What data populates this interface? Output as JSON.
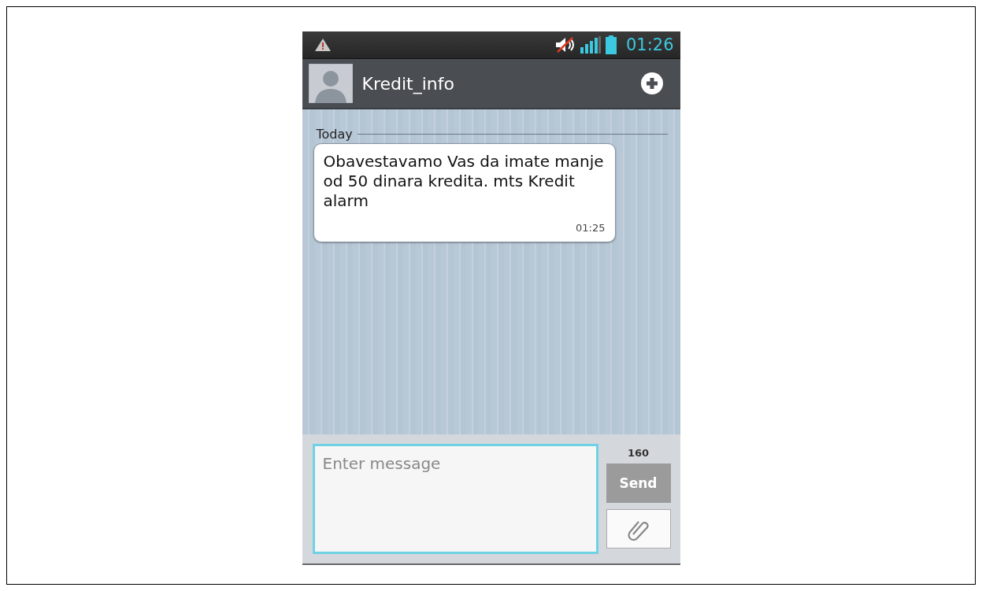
{
  "status_bar": {
    "time": "01:26"
  },
  "header": {
    "contact_name": "Kredit_info"
  },
  "conversation": {
    "date_divider": "Today",
    "messages": [
      {
        "text": "Obavestavamo Vas da imate manje od 50 dinara kredita. mts Kredit alarm",
        "time": "01:25"
      }
    ]
  },
  "composer": {
    "placeholder": "Enter message",
    "char_count": "160",
    "send_button": {
      "label": "Send",
      "disabled": true
    }
  }
}
